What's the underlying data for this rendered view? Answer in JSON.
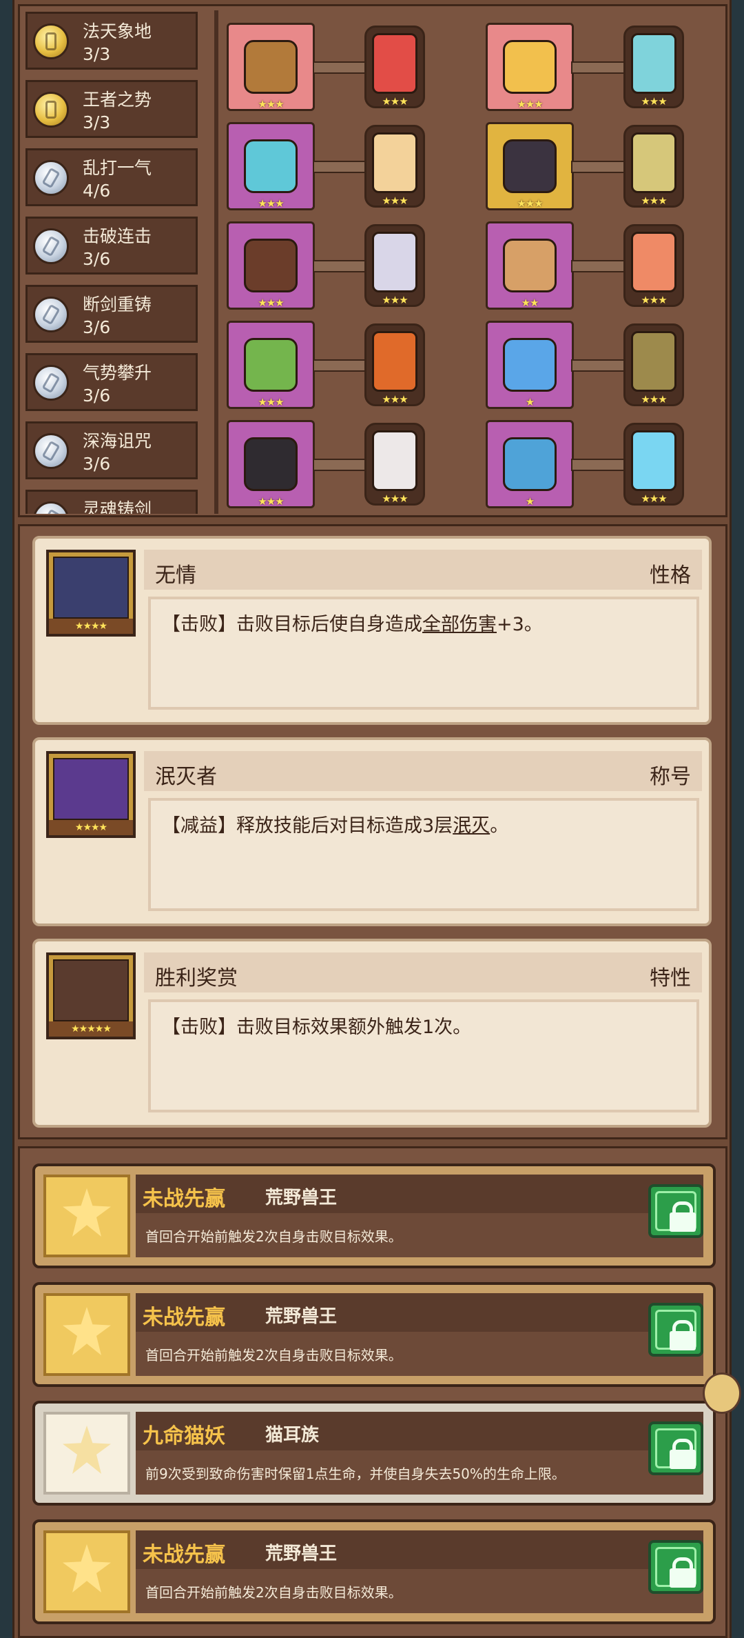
{
  "sets": [
    {
      "name": "法天象地",
      "count": "3/3",
      "coin": "gold"
    },
    {
      "name": "王者之势",
      "count": "3/3",
      "coin": "gold"
    },
    {
      "name": "乱打一气",
      "count": "4/6",
      "coin": "silver"
    },
    {
      "name": "击破连击",
      "count": "3/6",
      "coin": "silver"
    },
    {
      "name": "断剑重铸",
      "count": "3/6",
      "coin": "silver"
    },
    {
      "name": "气势攀升",
      "count": "3/6",
      "coin": "silver"
    },
    {
      "name": "深海诅咒",
      "count": "3/6",
      "coin": "silver"
    },
    {
      "name": "灵魂铸剑",
      "count": "",
      "coin": "silver"
    }
  ],
  "equipment_rows": [
    {
      "left_item": {
        "icon": "staff-icon",
        "stars": "★★★",
        "bg": "#e8898a",
        "item_color": "#b27a3a"
      },
      "left_card": {
        "icon": "red-rune-card-icon",
        "stars": "★★★",
        "color": "#e24d47"
      },
      "right_item": {
        "icon": "straw-hat-icon",
        "stars": "★★★",
        "bg": "#e8898a",
        "item_color": "#f2c04d"
      },
      "right_card": {
        "icon": "cyan-rune-card-icon",
        "stars": "★★★",
        "color": "#7fd3db"
      }
    },
    {
      "left_item": {
        "icon": "bracelet-icon",
        "stars": "★★★",
        "bg": "#b85fb1",
        "item_color": "#5fc8d8"
      },
      "left_card": {
        "icon": "sword-card-icon",
        "stars": "★★★",
        "color": "#f3d29a"
      },
      "right_item": {
        "icon": "armor-icon",
        "stars": "★★★",
        "bg": "#e1b440",
        "item_color": "#3b3340"
      },
      "right_card": {
        "icon": "gold-coin-card-icon",
        "stars": "★★★",
        "color": "#d6c77a"
      }
    },
    {
      "left_item": {
        "icon": "heart-necklace-icon",
        "stars": "★★★",
        "bg": "#b85fb1",
        "item_color": "#6b3d2a"
      },
      "left_card": {
        "icon": "silver-rune-card-icon",
        "stars": "★★★",
        "color": "#d9d6e8"
      },
      "right_item": {
        "icon": "glove-icon",
        "stars": "★★",
        "bg": "#b85fb1",
        "item_color": "#d7a067"
      },
      "right_card": {
        "icon": "target-card-icon",
        "stars": "★★★",
        "color": "#ef8a66"
      }
    },
    {
      "left_item": {
        "icon": "slime-mask-icon",
        "stars": "★★★",
        "bg": "#b85fb1",
        "item_color": "#74b54d"
      },
      "left_card": {
        "icon": "flame-card-icon",
        "stars": "★★★",
        "color": "#e06a2a"
      },
      "right_item": {
        "icon": "gem-ring-icon",
        "stars": "★",
        "bg": "#b85fb1",
        "item_color": "#5aa6e8"
      },
      "right_card": {
        "icon": "bronze-card-icon",
        "stars": "★★★",
        "color": "#9d8a4c"
      }
    },
    {
      "left_item": {
        "icon": "dark-ring-icon",
        "stars": "★★★",
        "bg": "#b85fb1",
        "item_color": "#2f2b30"
      },
      "left_card": {
        "icon": "white-card-icon",
        "stars": "★★★",
        "color": "#ede8e8"
      },
      "right_item": {
        "icon": "boots-icon",
        "stars": "★",
        "bg": "#b85fb1",
        "item_color": "#4fa3d8"
      },
      "right_card": {
        "icon": "ice-card-icon",
        "stars": "★★★",
        "color": "#7ad6f2"
      }
    }
  ],
  "buffs": [
    {
      "title": "无情",
      "tag": "性格",
      "stars": "★★★★",
      "desc_prefix": "【击败】击败目标后使自身造成",
      "desc_link": "全部伤害",
      "desc_suffix": "+3。",
      "portrait_color": "#3a3f6e"
    },
    {
      "title": "泯灭者",
      "tag": "称号",
      "stars": "★★★★",
      "desc_prefix": "【减益】释放技能后对目标造成3层",
      "desc_link": "泯灭",
      "desc_suffix": "。",
      "portrait_color": "#5b3a8e"
    },
    {
      "title": "胜利奖赏",
      "tag": "特性",
      "stars": "★★★★★",
      "desc_prefix": "【击败】击败目标效果额外触发1次。",
      "desc_link": "",
      "desc_suffix": "",
      "portrait_color": "#5a3b2e"
    }
  ],
  "skills": [
    {
      "name": "未战先赢",
      "race": "荒野兽王",
      "desc": "首回合开始前触发2次自身击败目标效果。",
      "style": "gold",
      "icon": "star-icon"
    },
    {
      "name": "未战先赢",
      "race": "荒野兽王",
      "desc": "首回合开始前触发2次自身击败目标效果。",
      "style": "gold",
      "icon": "star-icon"
    },
    {
      "name": "九命猫妖",
      "race": "猫耳族",
      "desc": "前9次受到致命伤害时保留1点生命，并使自身失去50%的生命上限。",
      "style": "white",
      "icon": "cat-icon"
    },
    {
      "name": "未战先赢",
      "race": "荒野兽王",
      "desc": "首回合开始前触发2次自身击败目标效果。",
      "style": "gold",
      "icon": "star-icon"
    }
  ]
}
